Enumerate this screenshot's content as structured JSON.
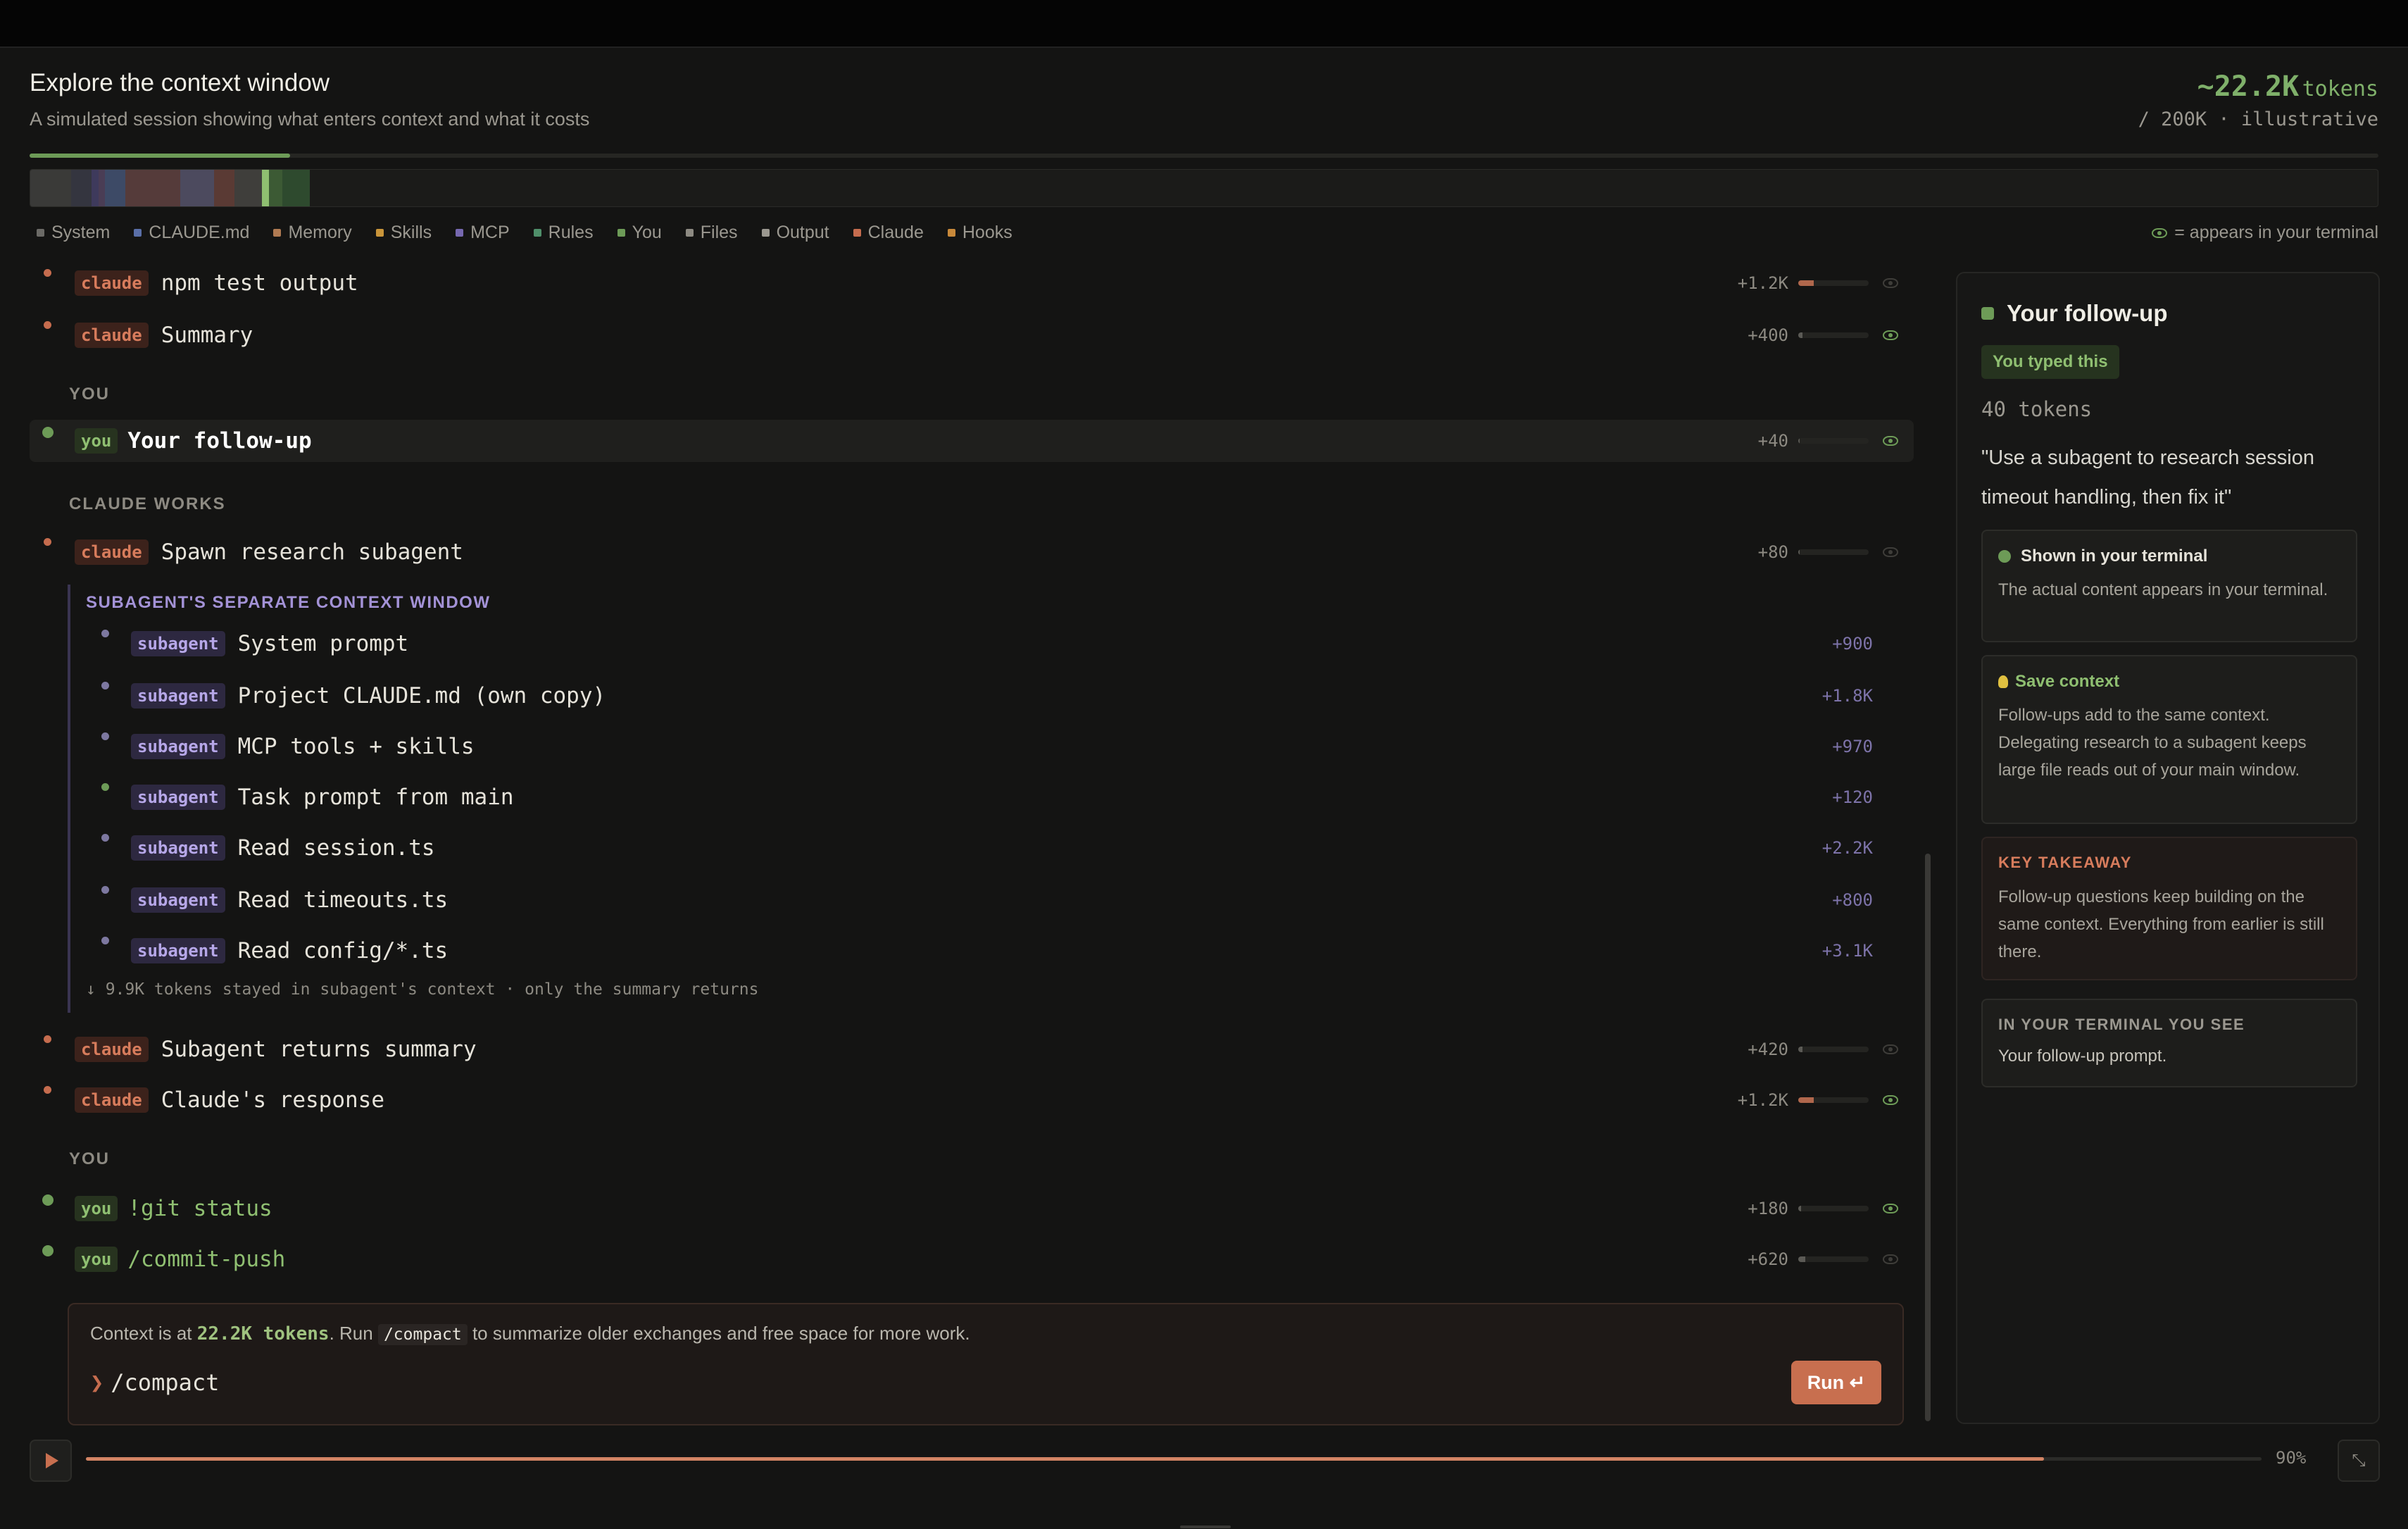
{
  "header": {
    "title": "Explore the context window",
    "subtitle": "A simulated session showing what enters context and what it costs",
    "tokens_value": "~22.2K",
    "tokens_unit": "tokens",
    "tokens_sub": "/ 200K · illustrative",
    "progress_fraction": 0.111
  },
  "legend": {
    "items": [
      {
        "label": "System",
        "color": "#6b6a66"
      },
      {
        "label": "CLAUDE.md",
        "color": "#5a6fa8"
      },
      {
        "label": "Memory",
        "color": "#b07a52"
      },
      {
        "label": "Skills",
        "color": "#c9953a"
      },
      {
        "label": "MCP",
        "color": "#7668b0"
      },
      {
        "label": "Rules",
        "color": "#4f8f6a"
      },
      {
        "label": "You",
        "color": "#6d9b57"
      },
      {
        "label": "Files",
        "color": "#8d8a82"
      },
      {
        "label": "Output",
        "color": "#9b9890"
      },
      {
        "label": "Claude",
        "color": "#c56c4e"
      },
      {
        "label": "Hooks",
        "color": "#c8893a"
      }
    ],
    "terminal_note": "= appears in your terminal"
  },
  "stack_segments": [
    {
      "color": "#3a3a38",
      "weight": 6
    },
    {
      "color": "#34353f",
      "weight": 3
    },
    {
      "color": "#3e3a5c",
      "weight": 1
    },
    {
      "color": "#4a3d55",
      "weight": 1
    },
    {
      "color": "#3d4a66",
      "weight": 3
    },
    {
      "color": "#553b3a",
      "weight": 8
    },
    {
      "color": "#4c4a5e",
      "weight": 5
    },
    {
      "color": "#5a3a34",
      "weight": 3
    },
    {
      "color": "#3f3e3b",
      "weight": 4
    },
    {
      "color": "#8fbf71",
      "weight": 1
    },
    {
      "color": "#3c5a34",
      "weight": 2
    },
    {
      "color": "#2e4a2e",
      "weight": 4
    }
  ],
  "stack_fraction": 0.119,
  "sections": {
    "you1": "YOU",
    "claude_works": "CLAUDE WORKS",
    "you2": "YOU"
  },
  "rows": [
    {
      "tag": "claude",
      "label": "npm test output",
      "delta": "+1.2K",
      "fill": 0.22,
      "visible": false
    },
    {
      "tag": "claude",
      "label": "Summary",
      "delta": "+400",
      "fill": 0.06,
      "visible": true
    },
    {
      "tag": "you",
      "label": "Your follow-up",
      "delta": "+40",
      "fill": 0.02,
      "visible": true,
      "selected": true
    },
    {
      "tag": "claude",
      "label": "Spawn research subagent",
      "delta": "+80",
      "fill": 0.02,
      "visible": false
    },
    {
      "tag": "claude",
      "label": "Subagent returns summary",
      "delta": "+420",
      "fill": 0.06,
      "visible": false
    },
    {
      "tag": "claude",
      "label": "Claude's response",
      "delta": "+1.2K",
      "fill": 0.22,
      "visible": true
    },
    {
      "tag": "you",
      "label": "!git status",
      "delta": "+180",
      "fill": 0.04,
      "visible": true
    },
    {
      "tag": "you",
      "label": "/commit-push",
      "delta": "+620",
      "fill": 0.1,
      "visible": false
    }
  ],
  "subagent": {
    "heading": "SUBAGENT'S SEPARATE CONTEXT WINDOW",
    "rows": [
      {
        "tag": "subagent",
        "label": "System prompt",
        "delta": "+900"
      },
      {
        "tag": "subagent",
        "label": "Project CLAUDE.md (own copy)",
        "delta": "+1.8K"
      },
      {
        "tag": "subagent",
        "label": "MCP tools + skills",
        "delta": "+970"
      },
      {
        "tag": "subagent",
        "label": "Task prompt from main",
        "delta": "+120"
      },
      {
        "tag": "subagent",
        "label": "Read session.ts",
        "delta": "+2.2K"
      },
      {
        "tag": "subagent",
        "label": "Read timeouts.ts",
        "delta": "+800"
      },
      {
        "tag": "subagent",
        "label": "Read config/*.ts",
        "delta": "+3.1K"
      }
    ],
    "note": "↓ 9.9K tokens stayed in subagent's context · only the summary returns"
  },
  "compact": {
    "msg_a": "Context is at ",
    "msg_tokens": "22.2K tokens",
    "msg_b": ". Run ",
    "msg_code": "/compact",
    "msg_c": " to summarize older exchanges and free space for more work.",
    "caret": "❯",
    "command": "/compact",
    "run_label": "Run ↵"
  },
  "panel": {
    "title": "Your follow-up",
    "badge": "You typed this",
    "tokens": "40 tokens",
    "quote": "\"Use a subagent to research session timeout handling, then fix it\"",
    "card1_title": "Shown in your terminal",
    "card1_body": "The actual content appears in your terminal.",
    "card2_title": "Save context",
    "card2_body": "Follow-ups add to the same context. Delegating research to a subagent keeps large file reads out of your main window.",
    "card3_title": "KEY TAKEAWAY",
    "card3_body": "Follow-up questions keep building on the same context. Everything from earlier is still there.",
    "card4_title": "IN YOUR TERMINAL YOU SEE",
    "card4_body": "Your follow-up prompt."
  },
  "player": {
    "progress_fraction": 0.9,
    "percent_label": "90%",
    "expand_icon": "⤡"
  }
}
